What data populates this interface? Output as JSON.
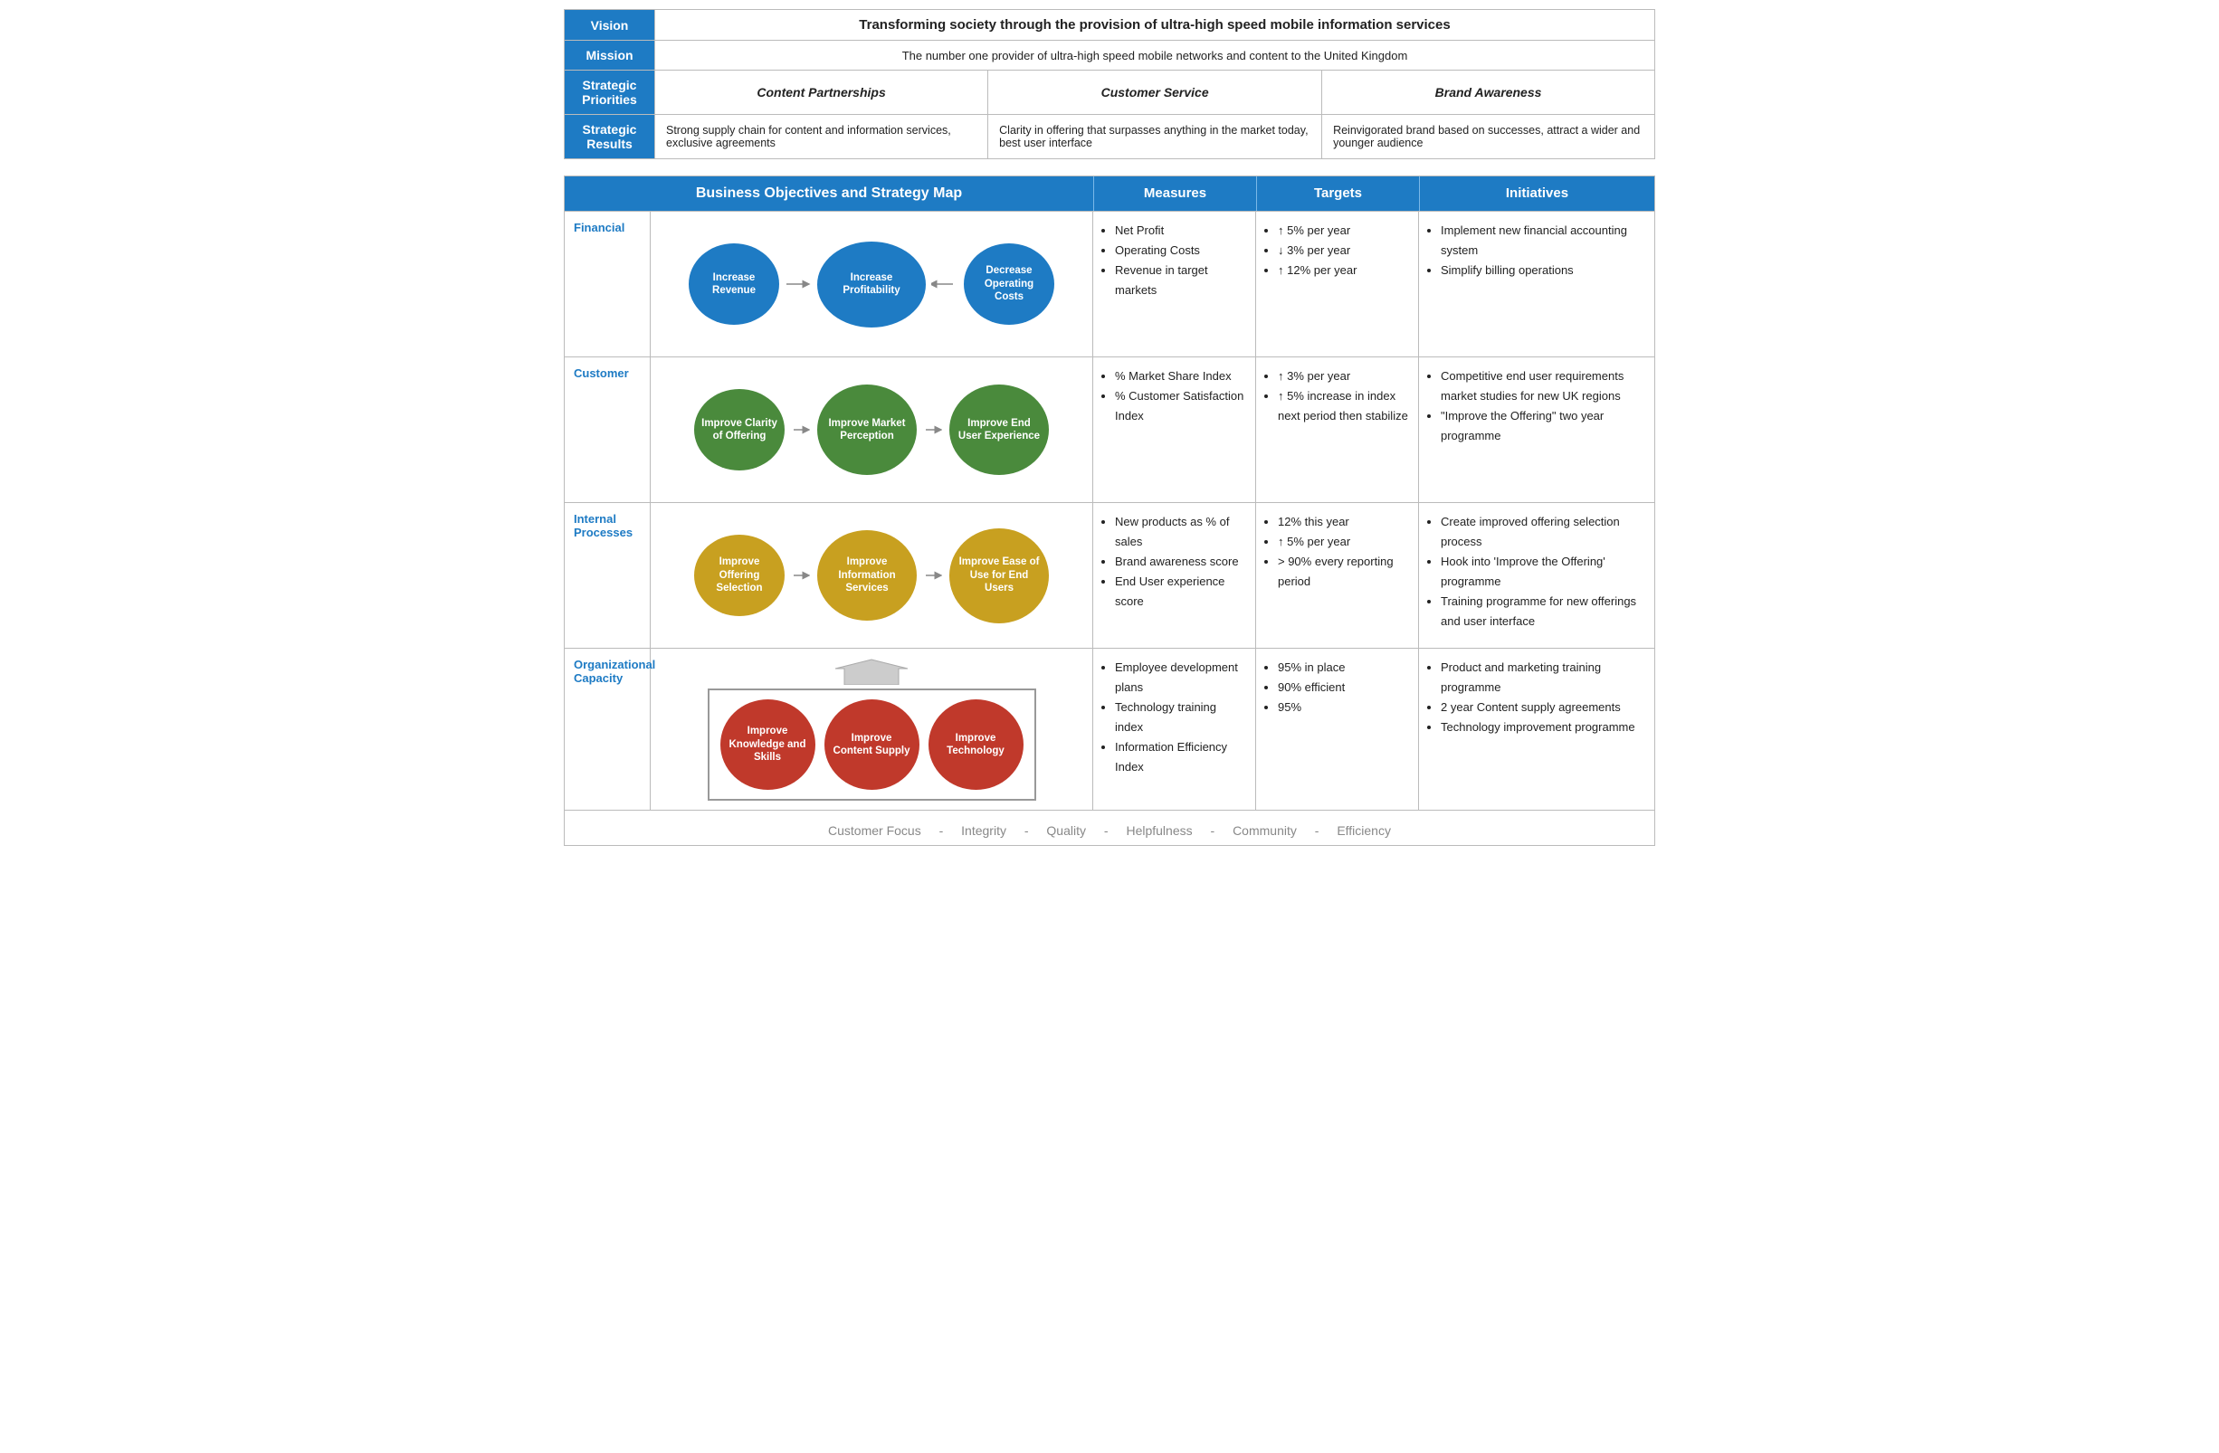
{
  "header": {
    "vision_label": "Vision",
    "vision_text": "Transforming society through the provision of ultra-high speed mobile information services",
    "mission_label": "Mission",
    "mission_text": "The number one provider of ultra-high speed mobile networks and content to the United Kingdom",
    "priorities_label": "Strategic Priorities",
    "priorities": [
      "Content Partnerships",
      "Customer Service",
      "Brand Awareness"
    ],
    "results_label": "Strategic Results",
    "results": [
      "Strong supply chain for content and information services, exclusive agreements",
      "Clarity in offering that surpasses anything in the market today, best user interface",
      "Reinvigorated brand based on successes, attract a wider and younger audience"
    ]
  },
  "strategy": {
    "title": "Business Objectives and Strategy Map",
    "col_measures": "Measures",
    "col_targets": "Targets",
    "col_initiatives": "Initiatives"
  },
  "financial": {
    "label": "Financial",
    "nodes": [
      "Increase Revenue",
      "Increase Profitability",
      "Decrease Operating Costs"
    ],
    "measures": [
      "Net Profit",
      "Operating Costs",
      "Revenue in target markets"
    ],
    "targets": [
      "↑ 5% per year",
      "↓ 3% per year",
      "↑ 12% per year"
    ],
    "initiatives": [
      "Implement new financial accounting system",
      "Simplify billing operations"
    ]
  },
  "customer": {
    "label": "Customer",
    "nodes": [
      "Improve Clarity of Offering",
      "Improve Market Perception",
      "Improve End User Experience"
    ],
    "measures": [
      "% Market Share Index",
      "% Customer Satisfaction Index"
    ],
    "targets": [
      "↑ 3% per year",
      "↑ 5% increase in index next period then stabilize"
    ],
    "initiatives": [
      "Competitive end user requirements market studies for new UK regions",
      "\"Improve the Offering\" two year programme"
    ]
  },
  "internal": {
    "label": "Internal Processes",
    "nodes": [
      "Improve Offering Selection",
      "Improve Information Services",
      "Improve Ease of Use for End Users"
    ],
    "measures": [
      "New products as % of sales",
      "Brand awareness score",
      "End User experience score"
    ],
    "targets": [
      "12% this year",
      "↑ 5% per year",
      "> 90% every reporting period"
    ],
    "initiatives": [
      "Create improved offering selection process",
      "Hook into 'Improve the Offering' programme",
      "Training programme for new offerings and user interface"
    ]
  },
  "org": {
    "label": "Organizational Capacity",
    "nodes": [
      "Improve Knowledge and Skills",
      "Improve Content Supply",
      "Improve Technology"
    ],
    "measures": [
      "Employee development plans",
      "Technology training index",
      "Information Efficiency Index"
    ],
    "targets": [
      "95% in place",
      "90% efficient",
      "95%"
    ],
    "initiatives": [
      "Product and marketing training programme",
      "2 year Content supply agreements",
      "Technology improvement programme"
    ]
  },
  "values": {
    "items": [
      "Customer Focus",
      "Integrity",
      "Quality",
      "Helpfulness",
      "Community",
      "Efficiency"
    ]
  }
}
